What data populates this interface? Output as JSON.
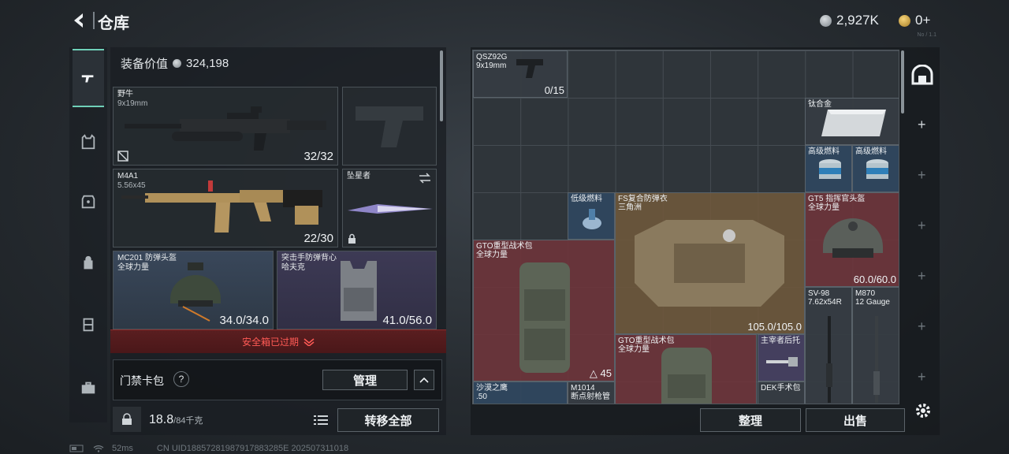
{
  "header": {
    "title": "仓库",
    "currency_silver": "2,927K",
    "currency_gold": "0+",
    "version_hint": "No / 1.1"
  },
  "loadout": {
    "equip_value_label": "装备价值",
    "equip_value": "324,198",
    "slots": {
      "primary1_name": "野牛",
      "primary1_caliber": "9x19mm",
      "primary1_ammo": "32/32",
      "primary2_name": "M4A1",
      "primary2_caliber": "5.56x45",
      "primary2_ammo": "22/30",
      "melee_name": "坠星者",
      "helmet_name": "MC201 防弹头盔",
      "helmet_sub": "全球力量",
      "helmet_dur": "34.0/34.0",
      "armor_name": "突击手防弹背心",
      "armor_sub": "哈夫克",
      "armor_dur": "41.0/56.0"
    },
    "safe_box_expired": "安全箱已过期",
    "access_card_label": "门禁卡包",
    "help": "?",
    "manage_button": "管理",
    "weight_value": "18.8",
    "weight_max": "/84千克",
    "transfer_all_button": "转移全部"
  },
  "storage": {
    "items": {
      "pistol_name": "QSZ92G",
      "pistol_caliber": "9x19mm",
      "pistol_count": "0/15",
      "titanium": "钛合金",
      "fuel_high_1": "高级燃料",
      "fuel_high_2": "高级燃料",
      "fuel_low": "低级燃料",
      "armor_name": "FS复合防弹衣",
      "armor_sub": "三角洲",
      "armor_dur": "105.0/105.0",
      "helmet_name": "GT5 指挥官头盔",
      "helmet_sub": "全球力量",
      "helmet_dur": "60.0/60.0",
      "bag1_name": "GTO重型战术包",
      "bag1_sub": "全球力量",
      "bag1_count": "45",
      "bag2_name": "GTO重型战术包",
      "bag2_sub": "全球力量",
      "stock_name": "主宰者后托",
      "sv98_name": "SV-98",
      "sv98_caliber": "7.62x54R",
      "m870_name": "M870",
      "m870_caliber": "12 Gauge",
      "sand_name": "沙漠之鹰",
      "sand_caliber": ".50",
      "m1014_name": "M1014",
      "m1014_sub": "断点射枪管",
      "dek_name": "DEK手术包"
    },
    "sort_button": "整理",
    "sell_button": "出售"
  },
  "status_bar": {
    "ping": "52ms",
    "uid": "CN UID18857281987917883285E 202507311018"
  },
  "colors": {
    "accent_teal": "#6fd0b8",
    "warning_red": "#ff5a55",
    "rarity_red": "#70343a",
    "rarity_gold": "#6e583c",
    "rarity_blue": "#304660",
    "rarity_purple": "#464062"
  }
}
